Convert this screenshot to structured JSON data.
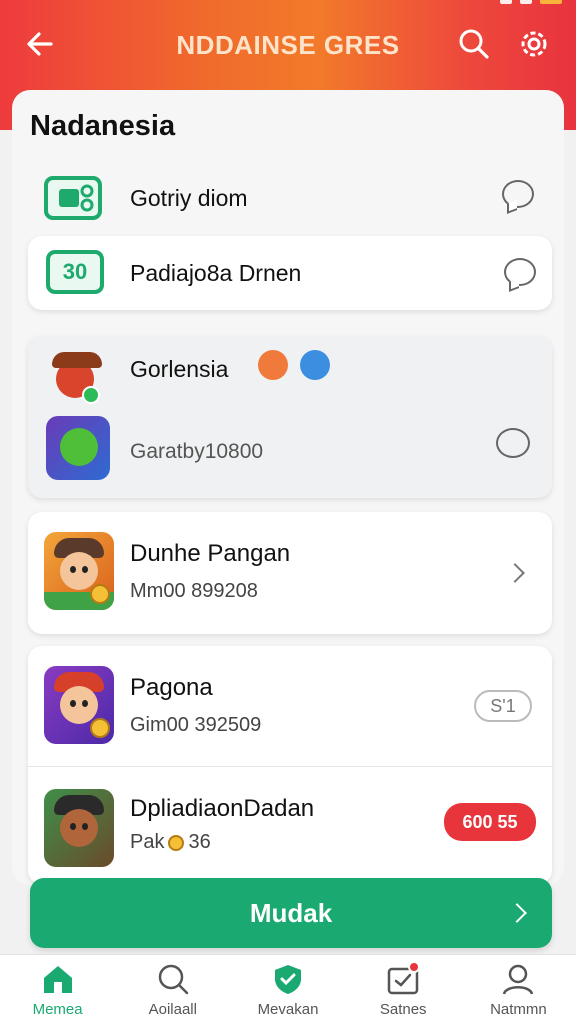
{
  "header": {
    "title": "NDDAINSE GRES",
    "back_icon": "arrow-left-icon",
    "search_icon": "search-icon",
    "settings_icon": "gear-icon"
  },
  "sheet": {
    "title": "Nadanesia"
  },
  "list": {
    "item1": {
      "label": "Gotriy diom",
      "icon": "ticket-icon"
    },
    "item2": {
      "label": "Padiajo8a Drnen",
      "icon_text": "30",
      "icon": "ticket-icon"
    },
    "group": {
      "label": "Gorlensia",
      "sub_label": "Garatby10800"
    },
    "item3": {
      "title": "Dunhe Pangan",
      "subtitle": "Mm00 899208"
    },
    "item4": {
      "title": "Pagona",
      "subtitle": "Gim00 392509",
      "pill": "S'1"
    },
    "item5": {
      "title": "DpliadiaonDadan",
      "subtitle_prefix": "Pak",
      "subtitle_value": "36",
      "pill": "600 55"
    }
  },
  "cta": {
    "label": "Mudak"
  },
  "tabs": [
    {
      "label": "Memea",
      "icon": "home-icon"
    },
    {
      "label": "Aoilaall",
      "icon": "search-icon"
    },
    {
      "label": "Mevakan",
      "icon": "shield-icon"
    },
    {
      "label": "Satnes",
      "icon": "inbox-icon"
    },
    {
      "label": "Natmmn",
      "icon": "profile-icon"
    }
  ],
  "colors": {
    "accent_green": "#1aaa71",
    "header_red": "#ee3b3d",
    "header_orange": "#f27a2a",
    "pill_red": "#e8343b"
  }
}
